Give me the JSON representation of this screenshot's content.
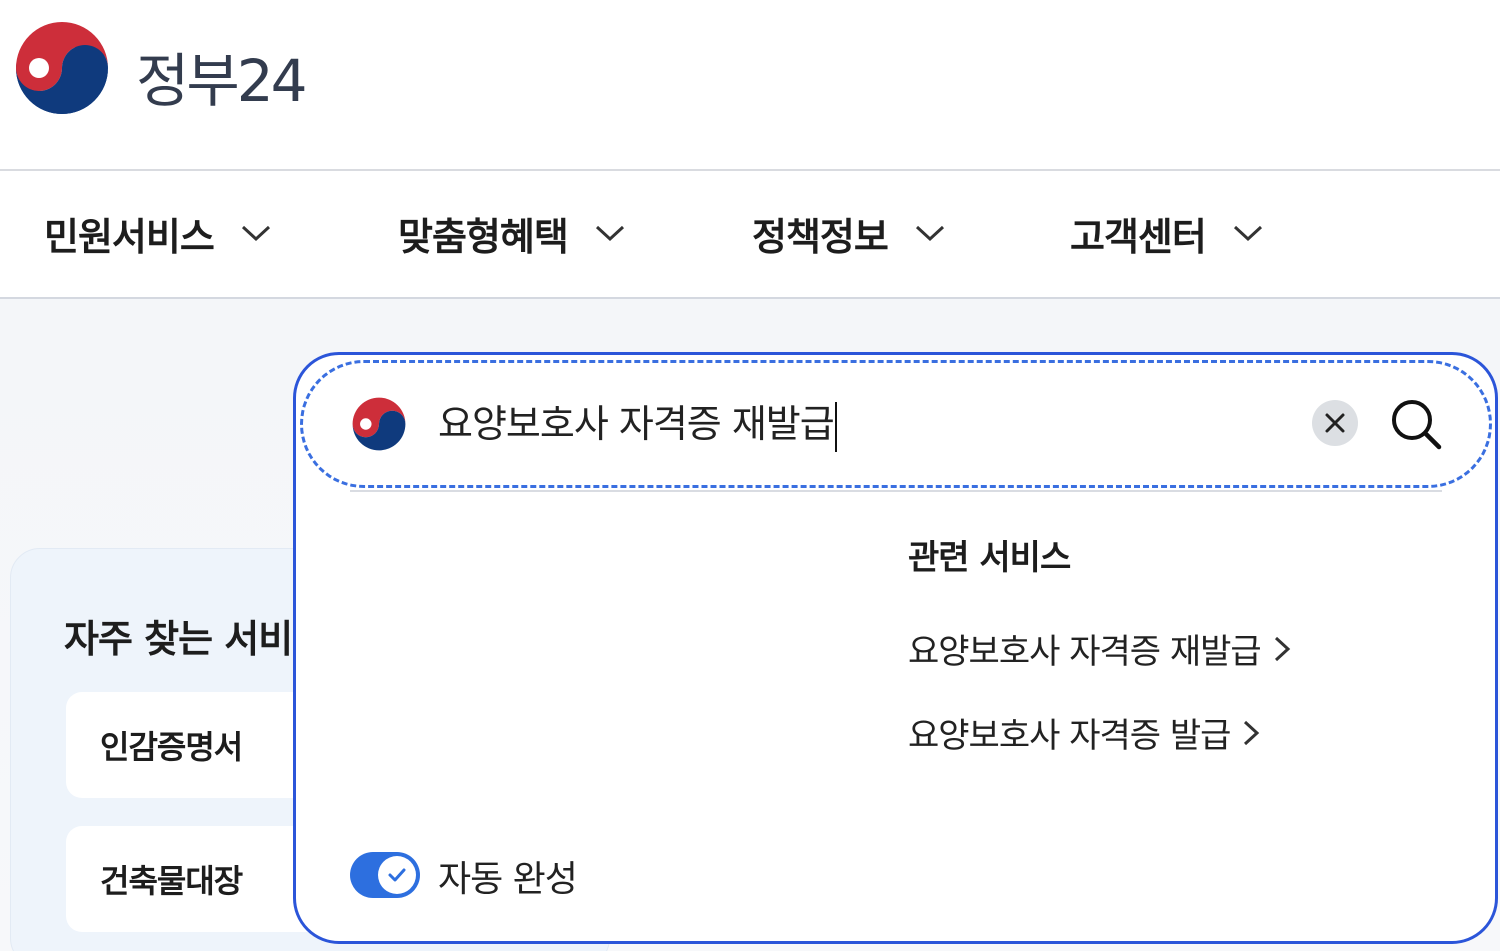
{
  "header": {
    "brand": "정부24",
    "logo_icon": "taegeuk-emblem-icon"
  },
  "nav": {
    "items": [
      {
        "label": "민원서비스"
      },
      {
        "label": "맞춤형혜택"
      },
      {
        "label": "정책정보"
      },
      {
        "label": "고객센터"
      }
    ]
  },
  "frequent": {
    "title": "자주 찾는 서비",
    "cards": [
      {
        "label": "인감증명서"
      },
      {
        "label": "건축물대장"
      }
    ]
  },
  "search": {
    "query": "요양보호사 자격증 재발급",
    "clear_icon": "close-icon",
    "search_icon": "search-icon"
  },
  "related": {
    "title": "관련 서비스",
    "links": [
      {
        "label": "요양보호사 자격증 재발급"
      },
      {
        "label": "요양보호사 자격증 발급"
      }
    ]
  },
  "autocomplete": {
    "label": "자동 완성",
    "enabled": true
  },
  "colors": {
    "accent": "#2b55d9",
    "toggle": "#2d6fdf",
    "emblem_red": "#cd2e3a",
    "emblem_blue": "#0f3a7d"
  }
}
